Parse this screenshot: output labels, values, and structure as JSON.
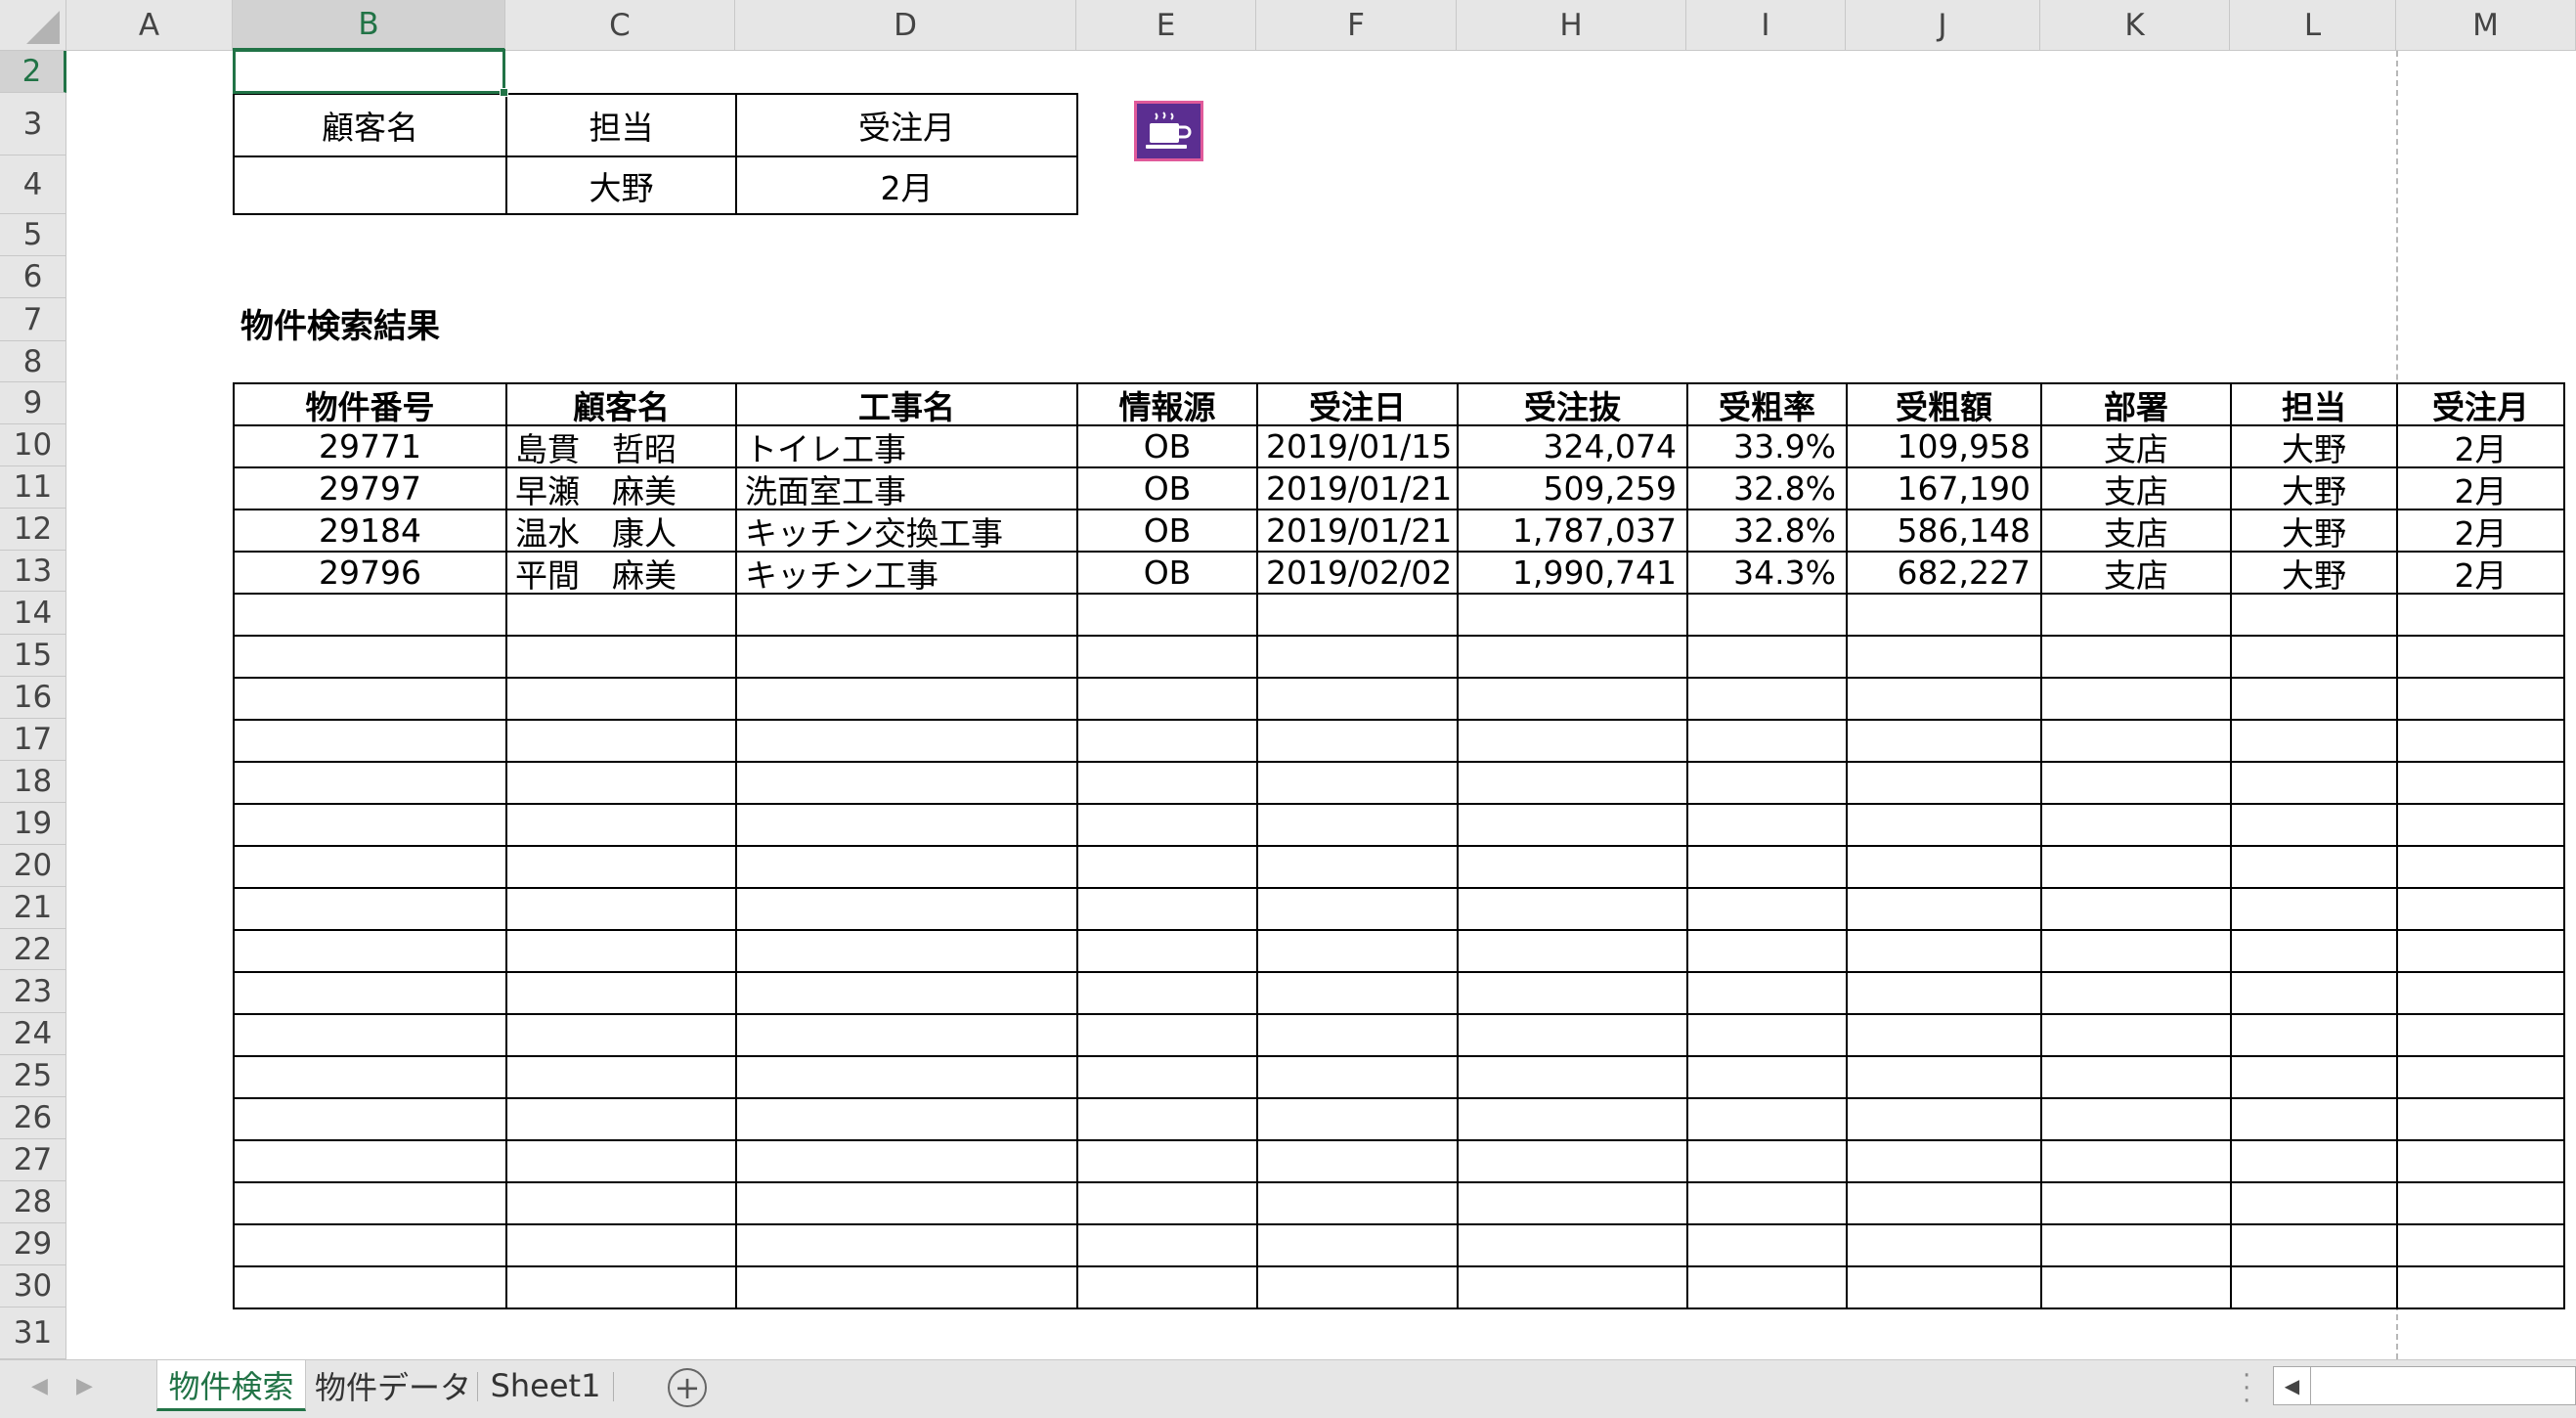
{
  "columns": [
    "A",
    "B",
    "C",
    "D",
    "E",
    "F",
    "H",
    "I",
    "J",
    "K",
    "L",
    "M"
  ],
  "rows": [
    "2",
    "3",
    "4",
    "5",
    "6",
    "7",
    "8",
    "9",
    "10",
    "11",
    "12",
    "13",
    "14",
    "15",
    "16",
    "17",
    "18",
    "19",
    "20",
    "21",
    "22",
    "23",
    "24",
    "25",
    "26",
    "27",
    "28",
    "29",
    "30",
    "31"
  ],
  "search_form": {
    "headers": [
      "顧客名",
      "担当",
      "受注月"
    ],
    "values": [
      "",
      "大野",
      "2月"
    ]
  },
  "result_title": "物件検索結果",
  "table": {
    "headers": [
      "物件番号",
      "顧客名",
      "工事名",
      "情報源",
      "受注日",
      "受注抜",
      "受粗率",
      "受粗額",
      "部署",
      "担当",
      "受注月"
    ],
    "rows": [
      [
        "29771",
        "島貫　哲昭",
        "トイレ工事",
        "OB",
        "2019/01/15",
        "324,074",
        "33.9%",
        "109,958",
        "支店",
        "大野",
        "2月"
      ],
      [
        "29797",
        "早瀬　麻美",
        "洗面室工事",
        "OB",
        "2019/01/21",
        "509,259",
        "32.8%",
        "167,190",
        "支店",
        "大野",
        "2月"
      ],
      [
        "29184",
        "温水　康人",
        "キッチン交換工事",
        "OB",
        "2019/01/21",
        "1,787,037",
        "32.8%",
        "586,148",
        "支店",
        "大野",
        "2月"
      ],
      [
        "29796",
        "平間　麻美",
        "キッチン工事",
        "OB",
        "2019/02/02",
        "1,990,741",
        "34.3%",
        "682,227",
        "支店",
        "大野",
        "2月"
      ]
    ]
  },
  "macro_button": {
    "icon": "coffee-cup-icon",
    "color": "#5b2e91"
  },
  "tabs": [
    {
      "label": "物件検索",
      "active": true
    },
    {
      "label": "物件データ",
      "active": false
    },
    {
      "label": "Sheet1",
      "active": false
    }
  ],
  "add_sheet_label": "+",
  "colors": {
    "accent": "#217346"
  }
}
